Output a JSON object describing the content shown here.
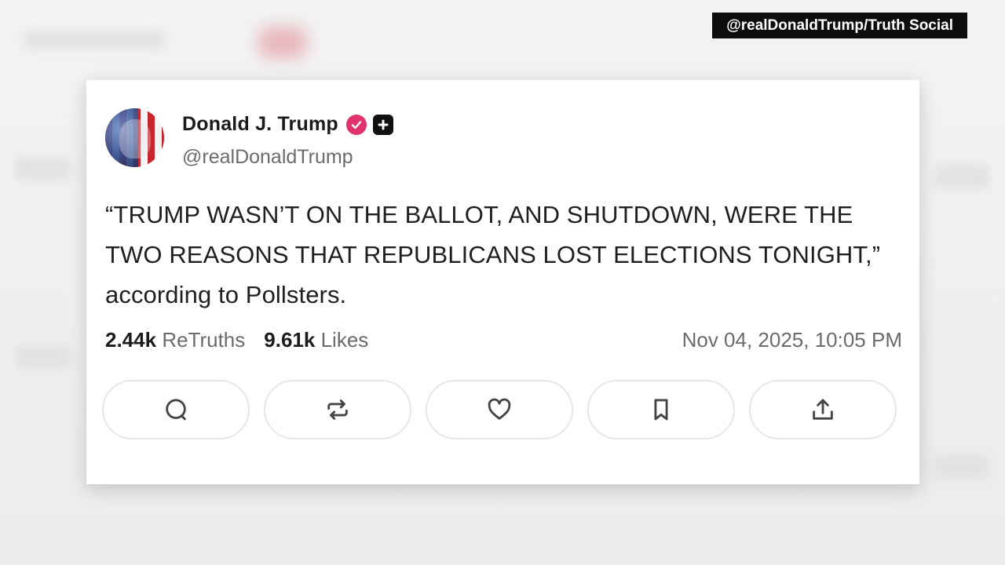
{
  "overlay": {
    "source_tag": "@realDonaldTrump/Truth Social"
  },
  "post": {
    "author_name": "Donald J. Trump",
    "author_handle": "@realDonaldTrump",
    "text": "“TRUMP WASN’T ON THE BALLOT, AND SHUTDOWN, WERE THE TWO REASONS THAT REPUBLICANS LOST ELECTIONS TONIGHT,” according to Pollsters.",
    "retruths_count": "2.44k",
    "retruths_label": "ReTruths",
    "likes_count": "9.61k",
    "likes_label": "Likes",
    "timestamp": "Nov 04, 2025, 10:05 PM",
    "icons": {
      "verified": "verified-badge-icon",
      "plus": "plus-badge-icon",
      "reply": "reply-icon",
      "retruth": "retruth-icon",
      "like": "heart-icon",
      "bookmark": "bookmark-icon",
      "share": "share-icon"
    },
    "colors": {
      "verified": "#e1346e"
    }
  }
}
